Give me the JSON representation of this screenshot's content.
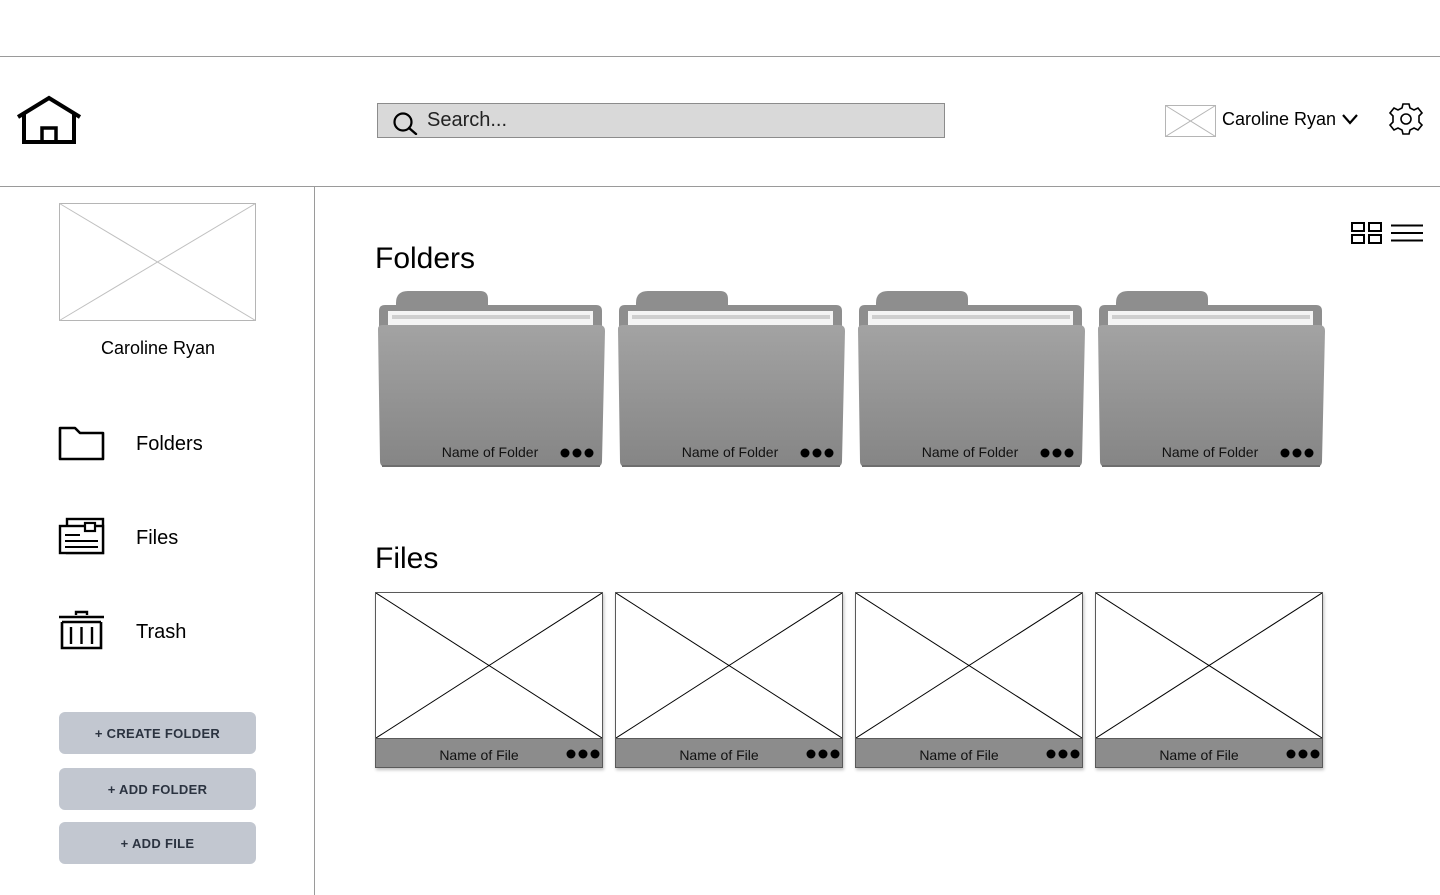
{
  "header": {
    "home_icon": "home-icon",
    "search": {
      "placeholder": "Search...",
      "value": "",
      "icon": "search-icon"
    },
    "user": {
      "name": "Caroline Ryan",
      "avatar": "avatar-placeholder-image",
      "dropdown_icon": "chevron-down-icon"
    },
    "settings_icon": "gear-icon"
  },
  "sidebar": {
    "profile": {
      "name": "Caroline Ryan",
      "image": "profile-placeholder-image"
    },
    "nav": [
      {
        "label": "Folders",
        "icon": "folder-icon"
      },
      {
        "label": "Files",
        "icon": "file-card-icon"
      },
      {
        "label": "Trash",
        "icon": "trash-icon"
      }
    ],
    "buttons": [
      {
        "label": "+ CREATE FOLDER"
      },
      {
        "label": "+ ADD FOLDER"
      },
      {
        "label": "+ ADD FILE"
      }
    ]
  },
  "main": {
    "view_toggles": [
      {
        "icon": "grid-view-icon"
      },
      {
        "icon": "list-view-icon"
      }
    ],
    "folders_title": "Folders",
    "folders": [
      {
        "name": "Name of Folder"
      },
      {
        "name": "Name of Folder"
      },
      {
        "name": "Name of Folder"
      },
      {
        "name": "Name of Folder"
      }
    ],
    "files_title": "Files",
    "files": [
      {
        "name": "Name of File"
      },
      {
        "name": "Name of File"
      },
      {
        "name": "Name of File"
      },
      {
        "name": "Name of File"
      }
    ]
  },
  "colors": {
    "search_bg": "#d9d9d9",
    "button_bg": "#c2c7d0",
    "button_text": "#2b3340",
    "folder_gray": "#8c8c8c",
    "divider": "#9a9a9a"
  }
}
